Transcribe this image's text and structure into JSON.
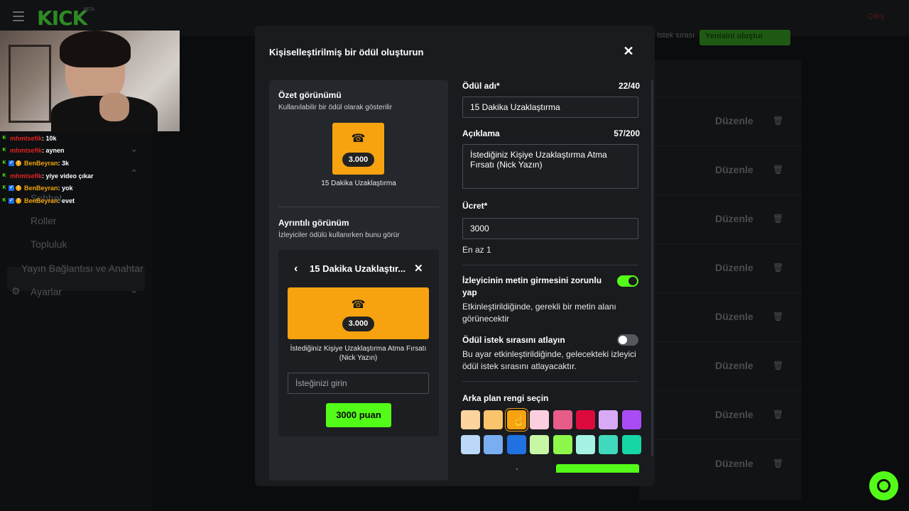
{
  "app": {
    "logo": "KICK",
    "logo_badge": "BETA",
    "top_right": "Çıkış"
  },
  "sidebar": {
    "items": [
      {
        "label": "Sohbet"
      },
      {
        "label": "Roller"
      },
      {
        "label": "Topluluk"
      },
      {
        "label": "Yayın Bağlantısı ve Anahtar"
      },
      {
        "label": "Ayarlar"
      }
    ]
  },
  "background": {
    "header_link": "Istek sırası",
    "create_button": "Yenisini oluştur",
    "edit_label": "Düzenle"
  },
  "chat": [
    {
      "user": "mhmtsefik",
      "user_color": "#e02424",
      "message": ": 10k",
      "badges": [
        "k"
      ]
    },
    {
      "user": "mhmtsefik",
      "user_color": "#e02424",
      "message": ": aynen",
      "badges": [
        "k"
      ]
    },
    {
      "user": "BenBeyran",
      "user_color": "#f0a30a",
      "message": ": 3k",
      "badges": [
        "k",
        "b",
        "o"
      ]
    },
    {
      "user": "mhmtsefik",
      "user_color": "#e02424",
      "message": ": yiye video çıkar",
      "badges": [
        "k"
      ]
    },
    {
      "user": "BenBeyran",
      "user_color": "#f0a30a",
      "message": ": yok",
      "badges": [
        "k",
        "b",
        "o"
      ]
    },
    {
      "user": "BenBeyran",
      "user_color": "#f0a30a",
      "message": ": evet",
      "badges": [
        "k",
        "b",
        "o"
      ]
    }
  ],
  "modal": {
    "title": "Kişiselleştirilmiş bir ödül oluşturun",
    "summary": {
      "title": "Özet görünümü",
      "subtitle": "Kullanılabilir bir ödül olarak gösterilir",
      "cost": "3.000",
      "name": "15 Dakika Uzaklaştırma"
    },
    "detail": {
      "title": "Ayrıntılı görünüm",
      "subtitle": "İzleyiciler ödülü kullanırken bunu görür",
      "reward_title": "15 Dakika Uzaklaştır...",
      "cost": "3.000",
      "description": "İstediğiniz Kişiye Uzaklaştırma Atma Fırsatı (Nick Yazın)",
      "input_placeholder": "İsteğinizi girin",
      "points_button": "3000 puan"
    },
    "form": {
      "name_label": "Ödül adı*",
      "name_count": "22/40",
      "name_value": "15 Dakika Uzaklaştırma",
      "desc_label": "Açıklama",
      "desc_count": "57/200",
      "desc_value": "İstediğiniz Kişiye Uzaklaştırma Atma Fırsatı (Nick Yazın)",
      "cost_label": "Ücret*",
      "cost_value": "3000",
      "cost_hint": "En az 1",
      "toggle1_label": "İzleyicinin metin girmesini zorunlu yap",
      "toggle1_desc": "Etkinleştirildiğinde, gerekli bir metin alanı görünecektir",
      "toggle1_on": true,
      "toggle2_label": "Ödül istek sırasını atlayın",
      "toggle2_desc": "Bu ayar etkinleştirildiğinde, gelecekteki izleyici ödül istek sırasını atlayacaktır.",
      "toggle2_on": false,
      "color_label": "Arka plan rengi seçin",
      "colors": [
        "#fdd49e",
        "#f9c46b",
        "#f7a30f",
        "#fbcfe0",
        "#e85c8a",
        "#dc0a3c",
        "#d8a9f7",
        "#a94cf5",
        "#bcd8f8",
        "#7aaef0",
        "#1f72e0",
        "#c7f7a4",
        "#8df84a",
        "#a6f3e4",
        "#40d9be",
        "#16d6a6"
      ],
      "selected_color": "#f7a30f"
    }
  },
  "accent": "#53fc18"
}
